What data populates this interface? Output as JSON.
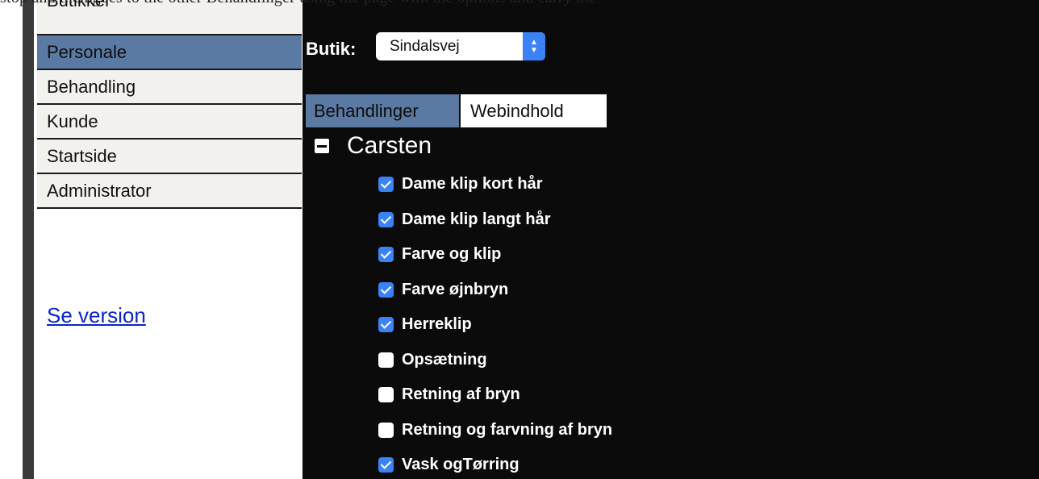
{
  "top_text": "stop and then goes to the other Behandlinger using the page with the options and carry the",
  "sidebar": {
    "items": [
      {
        "label": "Butikker",
        "active": false
      },
      {
        "label": "Personale",
        "active": true
      },
      {
        "label": "Behandling",
        "active": false
      },
      {
        "label": "Kunde",
        "active": false
      },
      {
        "label": "Startside",
        "active": false
      },
      {
        "label": "Administrator",
        "active": false
      }
    ],
    "version_link": "Se version"
  },
  "main": {
    "butik_label": "Butik:",
    "butik_selected": "Sindalsvej",
    "tabs": [
      {
        "label": "Behandlinger",
        "active": true
      },
      {
        "label": "Webindhold",
        "active": false
      }
    ],
    "group": {
      "name": "Carsten",
      "items": [
        {
          "label": "Dame klip kort hår",
          "checked": true
        },
        {
          "label": "Dame klip langt hår",
          "checked": true
        },
        {
          "label": "Farve og klip",
          "checked": true
        },
        {
          "label": "Farve øjnbryn",
          "checked": true
        },
        {
          "label": "Herreklip",
          "checked": true
        },
        {
          "label": "Opsætning",
          "checked": false
        },
        {
          "label": "Retning af bryn",
          "checked": false
        },
        {
          "label": "Retning og farvning af bryn",
          "checked": false
        },
        {
          "label": "Vask ogTørring",
          "checked": true
        }
      ]
    }
  },
  "colors": {
    "accent": "#5a7aa3",
    "checkbox_blue": "#3b82f6",
    "main_bg": "#0b0b0b",
    "link": "#0a25c9"
  }
}
